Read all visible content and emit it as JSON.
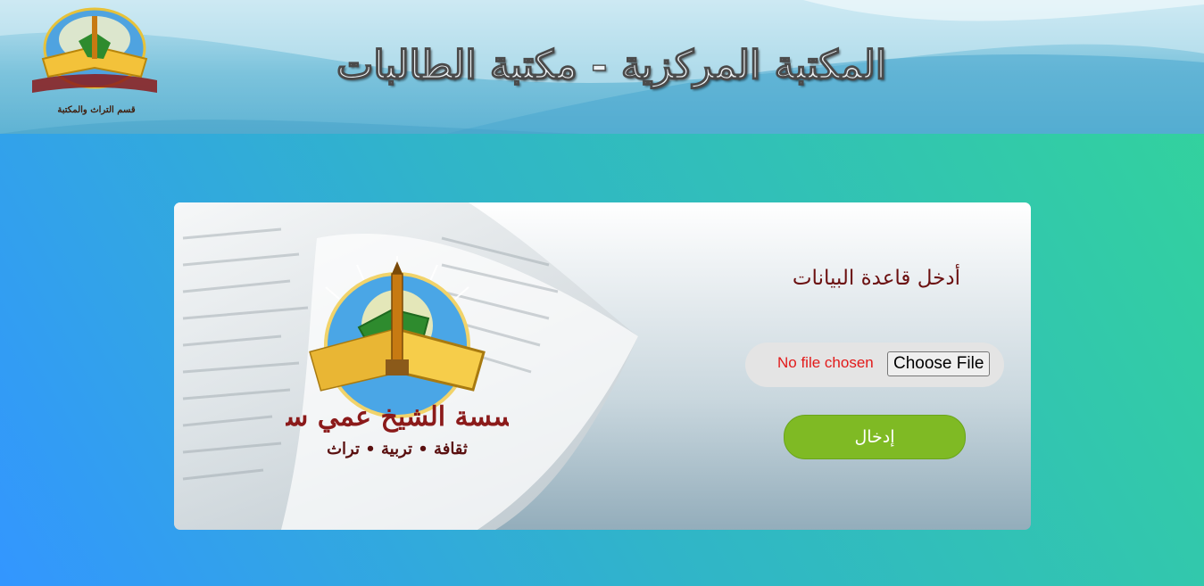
{
  "header": {
    "title": "المكتبة المركزية - مكتبة الطالبات",
    "logo_caption": "قسم التراث والمكتبة"
  },
  "card": {
    "form_title": "أدخل قاعدة البيانات",
    "file_status": "No file chosen",
    "choose_file_label": "Choose File",
    "submit_label": "إدخال"
  },
  "logo": {
    "name": "مؤسسة الشيخ عمي سعيد",
    "tagline": "ثقافة • تربية • تراث"
  },
  "colors": {
    "title_text": "#6b1010",
    "file_status": "#e21a1a",
    "submit_bg": "#7fba24",
    "logo_text": "#8b1a1a"
  },
  "icons": [
    "institution-logo-icon",
    "open-book-image"
  ]
}
